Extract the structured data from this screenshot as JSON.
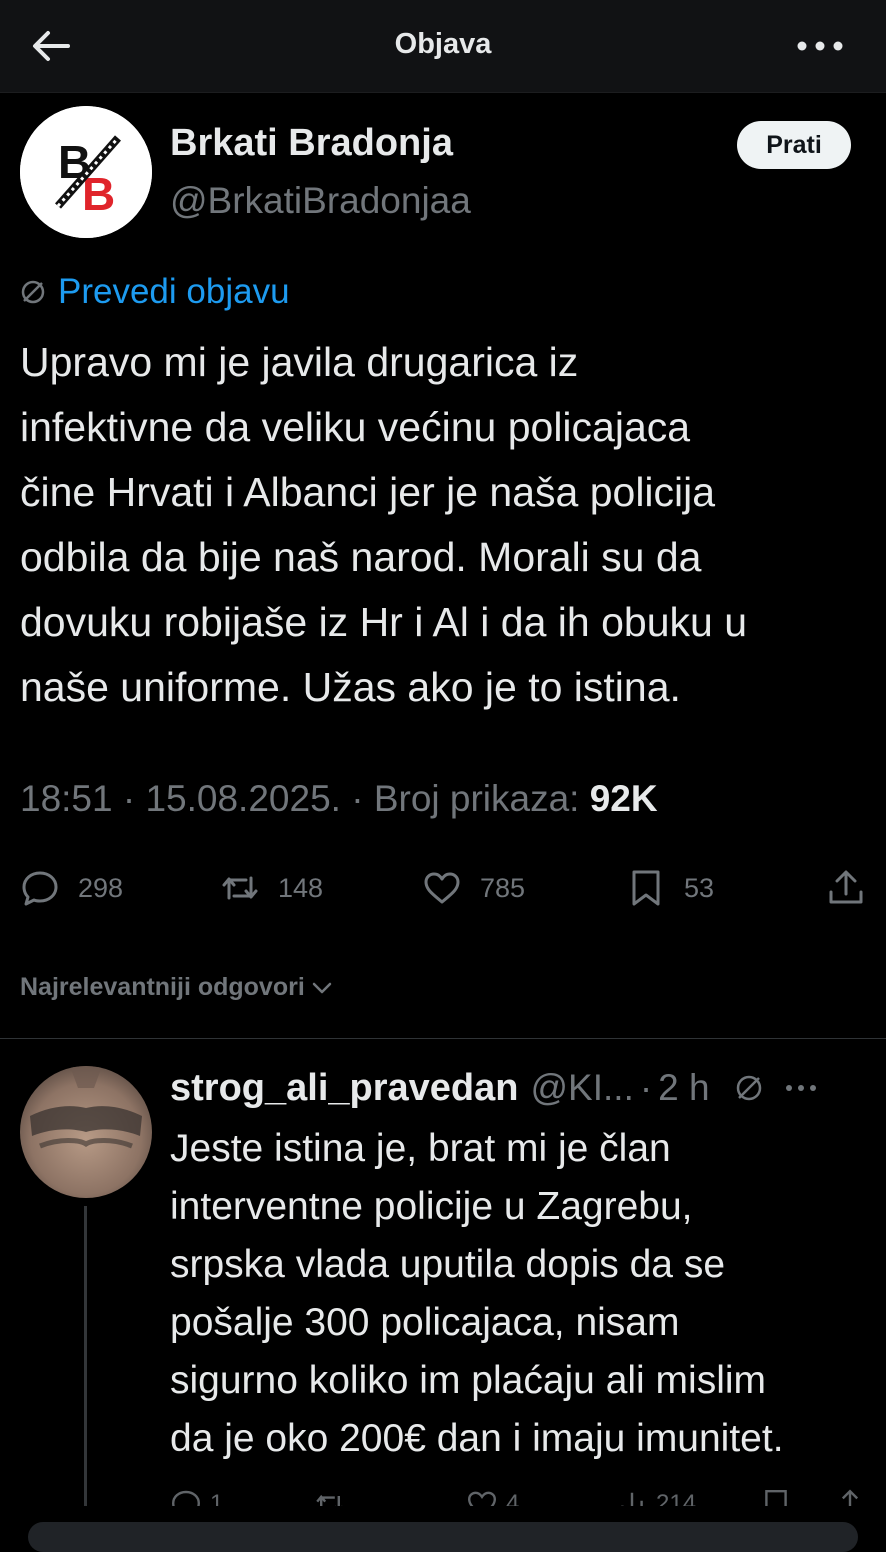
{
  "topbar": {
    "title": "Objava"
  },
  "author": {
    "name": "Brkati Bradonja",
    "handle": "@BrkatiBradonjaa",
    "follow_label": "Prati"
  },
  "translate": {
    "label": "Prevedi objavu"
  },
  "tweet": {
    "text": "Upravo mi je javila drugarica iz\ninfektivne da veliku većinu policajaca\nčine Hrvati i Albanci jer je naša policija\nodbila da bije naš narod. Morali su da\ndovuku robijaše iz Hr i Al i da ih obuku u\nnaše uniforme. Užas ako je to istina.",
    "meta_prefix": "18:51 · 15.08.2025. · Broj prikaza: ",
    "views": "92K"
  },
  "actions": {
    "replies": "298",
    "reposts": "148",
    "likes": "785",
    "bookmarks": "53"
  },
  "sort": {
    "label": "Najrelevantniji odgovori"
  },
  "reply": {
    "name": "strog_ali_pravedan",
    "handle": "@KI...",
    "dot": "·",
    "time": "2 h",
    "text": "Jeste istina je, brat mi je član\ninterventne policije u Zagrebu,\nsrpska vlada uputila dopis da se\npošalje 300 policajaca, nisam\nsigurno koliko im plaćaju ali mislim\nda je oko 200€ dan i imaju imunitet.",
    "actions": {
      "replies": "1",
      "likes": "4",
      "views": "214"
    }
  },
  "colors": {
    "background": "#000000",
    "link": "#1d9bf0",
    "muted": "#71767b",
    "text": "#e7e9ea",
    "logo_red": "#e0242b"
  },
  "icons": [
    "back-arrow-icon",
    "more-icon",
    "globe-icon",
    "reply-icon",
    "repost-icon",
    "like-icon",
    "bookmark-icon",
    "share-icon",
    "chevron-down-icon",
    "views-icon"
  ]
}
